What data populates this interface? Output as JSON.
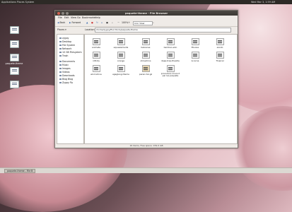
{
  "topbar": {
    "menu": "Applications Places System",
    "clock": "Wed Mar 3, 1:59 AM"
  },
  "desktop_icons": [
    {
      "label": ""
    },
    {
      "label": ""
    },
    {
      "label": "paquete-theme"
    },
    {
      "label": ""
    },
    {
      "label": ""
    }
  ],
  "window": {
    "title": "paquete-theme - File Browser",
    "menu": [
      "File",
      "Edit",
      "View",
      "Go",
      "Bookmarks",
      "Help"
    ],
    "toolbar": {
      "back": "Back",
      "forward": "Forward",
      "zoom": "100%",
      "view_mode": "Icon View"
    },
    "location_label": "Location:",
    "location_value": "/home/zygoy/Escritorio/paquete-theme",
    "sidebar_header": "Places",
    "sidebar": [
      "zygoy",
      "Desktop",
      "File System",
      "Network",
      "10 GB Filesystem",
      "Trash",
      "Documents",
      "Music",
      "Images",
      "Videos",
      "Downloads",
      "Blog Blog",
      "Zygoy Pp"
    ],
    "files": [
      {
        "name": "animate"
      },
      {
        "name": "aquaelements"
      },
      {
        "name": "balances"
      },
      {
        "name": "bamboo-skin"
      },
      {
        "name": "Elusive"
      },
      {
        "name": "exodo"
      },
      {
        "name": "infinity"
      },
      {
        "name": "orange"
      },
      {
        "name": "shinedrins"
      },
      {
        "name": "deep-tree-theatre"
      },
      {
        "name": "lucerna"
      },
      {
        "name": "Tropical"
      },
      {
        "name": "wind-shine"
      },
      {
        "name": "egeglang-theme"
      },
      {
        "name": "pereni.tar.gz"
      },
      {
        "name": "procedure move it par les paquete"
      }
    ],
    "status": "16 items, Free space: 159.0 GB"
  },
  "taskbar": {
    "item": "paquete-theme - File B"
  }
}
